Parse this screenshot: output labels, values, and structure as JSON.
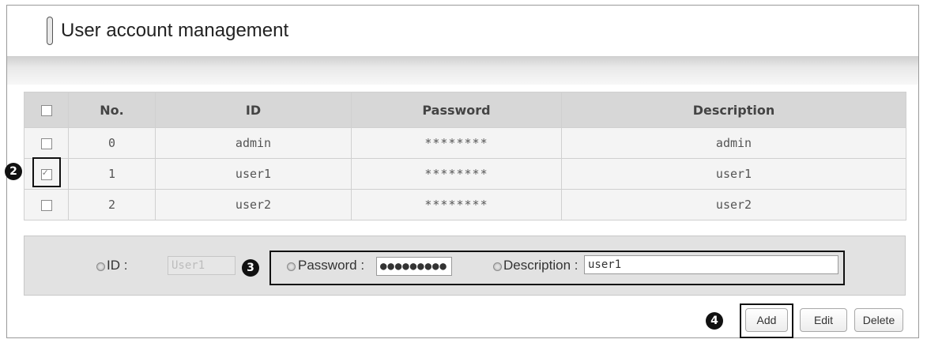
{
  "window": {
    "title": "User account management"
  },
  "table": {
    "columns": {
      "select_all": false,
      "no": "No.",
      "id": "ID",
      "password": "Password",
      "description": "Description"
    },
    "rows": [
      {
        "checked": false,
        "no": "0",
        "id": "admin",
        "password": "********",
        "description": "admin"
      },
      {
        "checked": true,
        "no": "1",
        "id": "user1",
        "password": "********",
        "description": "user1"
      },
      {
        "checked": false,
        "no": "2",
        "id": "user2",
        "password": "********",
        "description": "user2"
      }
    ]
  },
  "form": {
    "id_label": "ID :",
    "id_value": "User1",
    "password_label": "Password :",
    "password_value": "●●●●●●●●●",
    "description_label": "Description :",
    "description_value": "user1"
  },
  "buttons": {
    "add": "Add",
    "edit": "Edit",
    "delete": "Delete"
  },
  "callouts": {
    "row_checkbox": "2",
    "fields": "3",
    "add_button": "4"
  }
}
